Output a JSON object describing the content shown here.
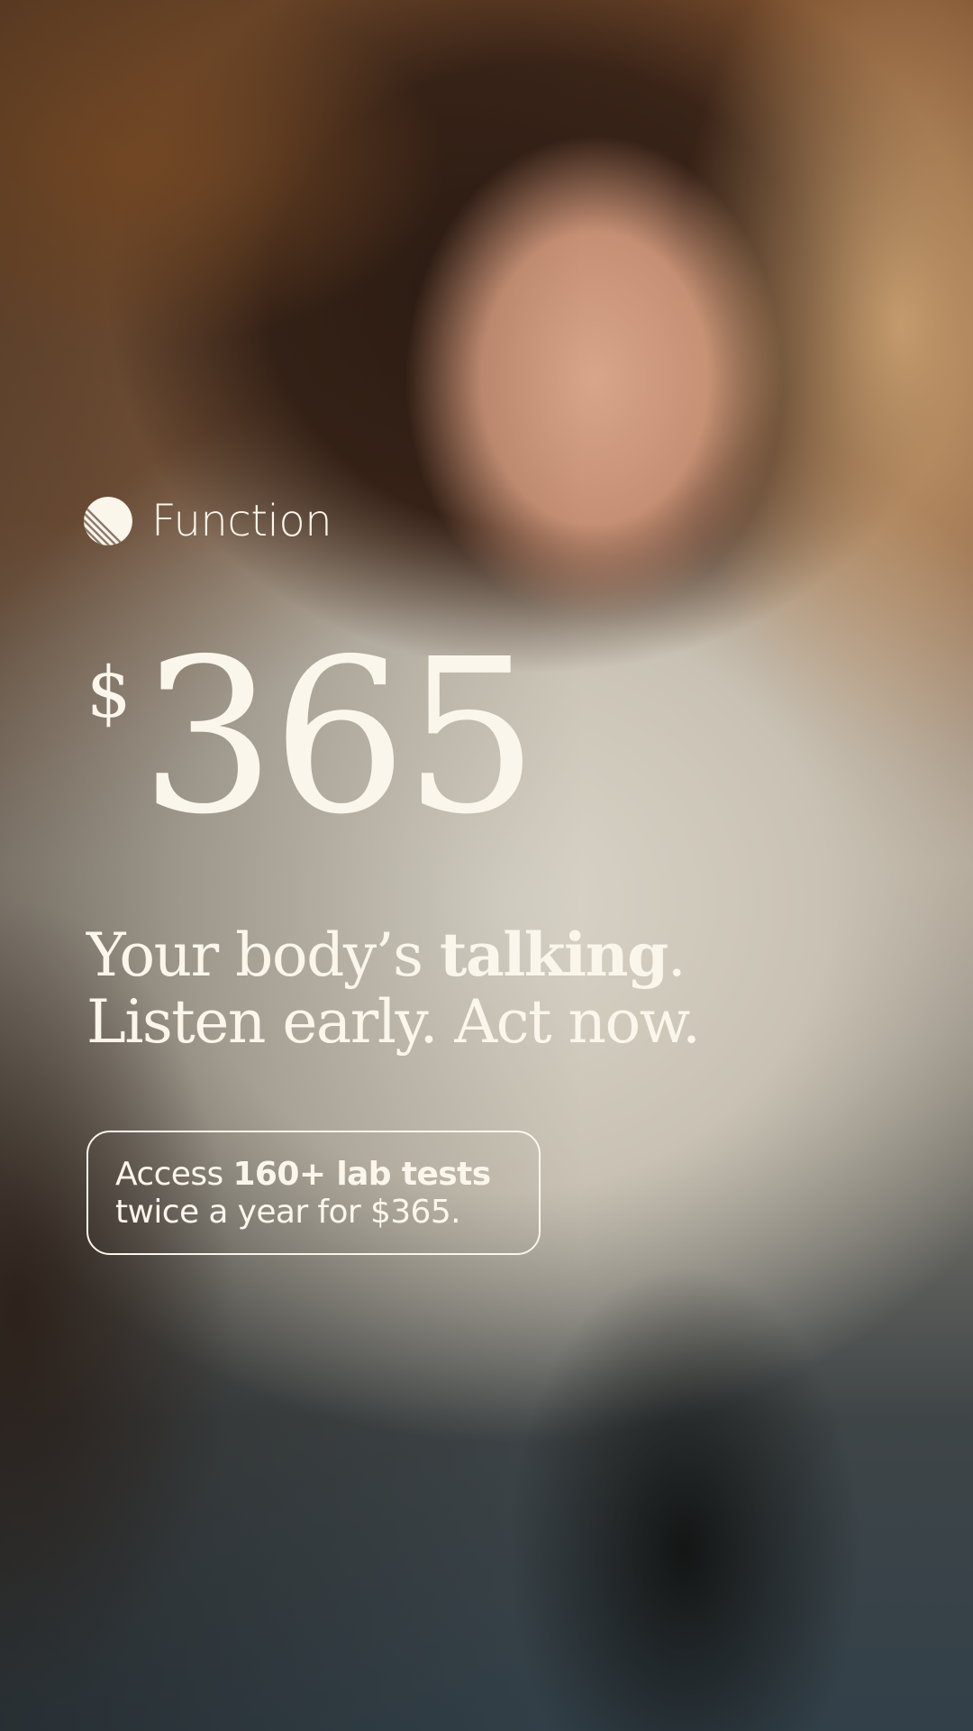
{
  "brand": {
    "name": "Function",
    "logo_icon": "striped-circle-icon"
  },
  "price": {
    "currency": "$",
    "amount": "365"
  },
  "headline": {
    "line1_start": "Your body’s ",
    "line1_bold": "talking",
    "line1_end": ".",
    "line2": "Listen early. Act now."
  },
  "offer": {
    "prefix": "Access ",
    "bold": "160+ lab tests",
    "line2": "twice a year for $365."
  },
  "colors": {
    "text": "#fbf6ec"
  }
}
